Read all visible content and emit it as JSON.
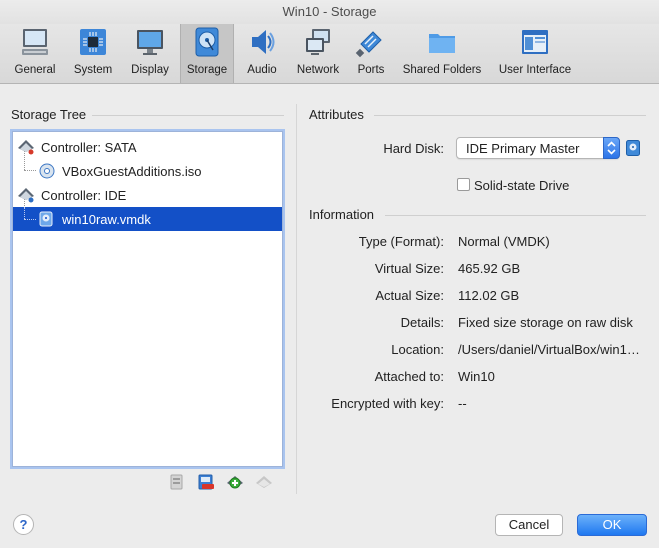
{
  "window": {
    "title": "Win10 - Storage"
  },
  "toolbar": {
    "items": [
      {
        "label": "General",
        "icon": "monitor-general-icon",
        "active": false
      },
      {
        "label": "System",
        "icon": "chip-icon",
        "active": false
      },
      {
        "label": "Display",
        "icon": "display-icon",
        "active": false
      },
      {
        "label": "Storage",
        "icon": "disk-icon",
        "active": true
      },
      {
        "label": "Audio",
        "icon": "speaker-icon",
        "active": false
      },
      {
        "label": "Network",
        "icon": "network-icon",
        "active": false
      },
      {
        "label": "Ports",
        "icon": "ports-icon",
        "active": false
      },
      {
        "label": "Shared Folders",
        "icon": "folder-icon",
        "active": false
      },
      {
        "label": "User Interface",
        "icon": "window-icon",
        "active": false
      }
    ]
  },
  "storage_tree": {
    "heading": "Storage Tree",
    "items": [
      {
        "label": "Controller: SATA",
        "type": "controller"
      },
      {
        "label": "VBoxGuestAdditions.iso",
        "type": "optical"
      },
      {
        "label": "Controller: IDE",
        "type": "controller"
      },
      {
        "label": "win10raw.vmdk",
        "type": "harddisk",
        "selected": true
      }
    ]
  },
  "attributes": {
    "heading": "Attributes",
    "hard_disk_label": "Hard Disk:",
    "hard_disk_value": "IDE Primary Master",
    "ssd_label": "Solid-state Drive"
  },
  "information": {
    "heading": "Information",
    "rows": [
      {
        "label": "Type (Format):",
        "value": "Normal (VMDK)"
      },
      {
        "label": "Virtual Size:",
        "value": "465.92 GB"
      },
      {
        "label": "Actual Size:",
        "value": "112.02 GB"
      },
      {
        "label": "Details:",
        "value": "Fixed size storage on raw disk"
      },
      {
        "label": "Location:",
        "value": "/Users/daniel/VirtualBox/win1…"
      },
      {
        "label": "Attached to:",
        "value": "Win10"
      },
      {
        "label": "Encrypted with key:",
        "value": "--"
      }
    ]
  },
  "footer": {
    "help": "?",
    "cancel": "Cancel",
    "ok": "OK"
  },
  "colors": {
    "selection": "#1350c7",
    "accent": "#1f78f0"
  }
}
